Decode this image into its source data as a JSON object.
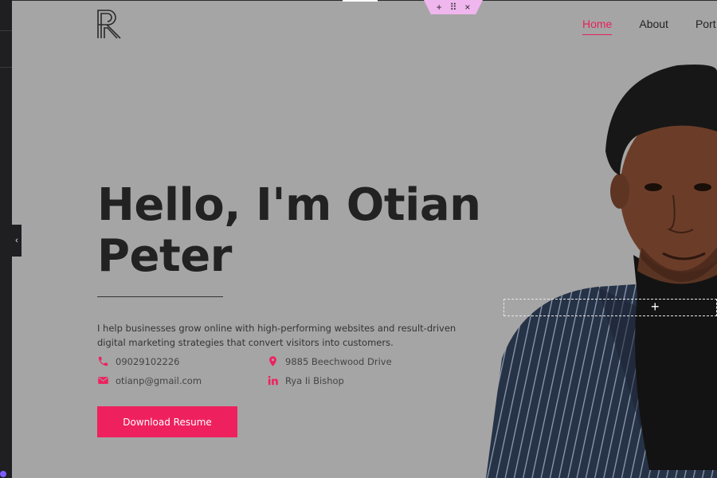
{
  "section_toolbar": {
    "add": "+",
    "handle": "⠿",
    "close": "×"
  },
  "panel_toggle": "‹",
  "nav": {
    "items": [
      "Home",
      "About",
      "Port"
    ]
  },
  "hero": {
    "headline_line1": "Hello, I'm Otian",
    "headline_line2": "Peter",
    "intro": "I help businesses grow online with high-performing websites and result-driven digital marketing strategies that convert visitors into customers.",
    "contacts": {
      "phone": "09029102226",
      "address": "9885 Beechwood Drive",
      "email": "otianp@gmail.com",
      "linkedin": "Rya Ii Bishop"
    },
    "cta_label": "Download Resume"
  },
  "dropzone_plus": "+",
  "colors": {
    "accent": "#ee215e",
    "background": "#a5a5a5",
    "text": "#222222"
  }
}
